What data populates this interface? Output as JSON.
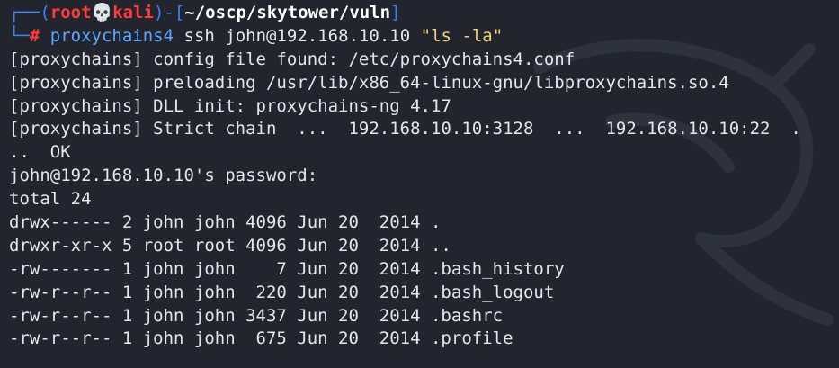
{
  "prompt": {
    "top_left": "┌──(",
    "user": "root",
    "skull": "💀",
    "host": "kali",
    "mid": ")-[",
    "path": "~/oscp/skytower/vuln",
    "close": "]",
    "bottom_left": "└─",
    "hash": "#",
    "command": "proxychains4",
    "args": "ssh john@192.168.10.10",
    "quoted": "\"ls -la\""
  },
  "output_lines": [
    "[proxychains] config file found: /etc/proxychains4.conf",
    "[proxychains] preloading /usr/lib/x86_64-linux-gnu/libproxychains.so.4",
    "[proxychains] DLL init: proxychains-ng 4.17",
    "[proxychains] Strict chain  ...  192.168.10.10:3128  ...  192.168.10.10:22  .",
    "..  OK",
    "john@192.168.10.10's password:",
    "total 24",
    "drwx------ 2 john john 4096 Jun 20  2014 .",
    "drwxr-xr-x 5 root root 4096 Jun 20  2014 ..",
    "-rw------- 1 john john    7 Jun 20  2014 .bash_history",
    "-rw-r--r-- 1 john john  220 Jun 20  2014 .bash_logout",
    "-rw-r--r-- 1 john john 3437 Jun 20  2014 .bashrc",
    "-rw-r--r-- 1 john john  675 Jun 20  2014 .profile"
  ],
  "colors": {
    "background": "#22252e",
    "text": "#e6e6e6",
    "prompt_box": "#3b82f6",
    "prompt_user": "#ff3b3b",
    "command": "#5aa8ff",
    "string": "#f0d37a"
  },
  "icons": {
    "skull": "skull-icon",
    "watermark": "kali-dragon-icon"
  }
}
